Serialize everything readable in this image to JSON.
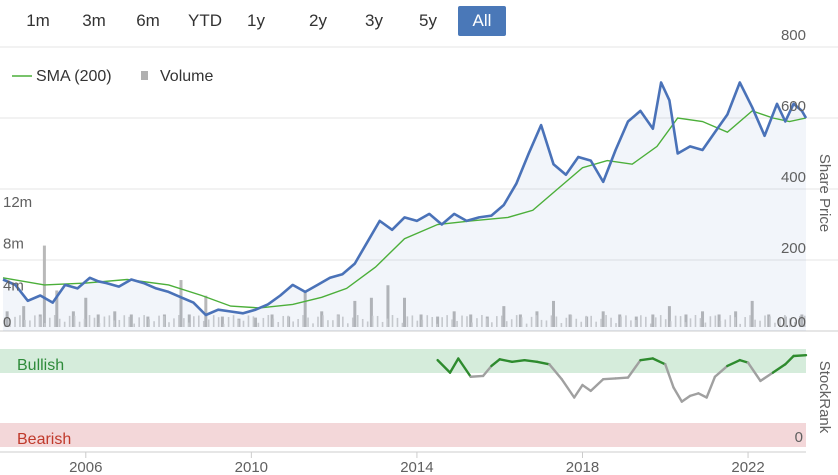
{
  "range_selector": {
    "buttons": [
      "1m",
      "3m",
      "6m",
      "YTD",
      "1y",
      "2y",
      "3y",
      "5y",
      "All"
    ],
    "active": "All"
  },
  "legend": {
    "sma_label": "SMA (200)",
    "volume_label": "Volume"
  },
  "colors": {
    "price": "#4a72b8",
    "sma": "#4caf3a",
    "volume": "#b9b9b9",
    "active_button": "#4a78b8",
    "bullish_band": "#d5ecdb",
    "bearish_band": "#f3d7d9",
    "bullish_text": "#2e8b3a",
    "bearish_text": "#c0392b",
    "stockrank_bull": "#2e8b2e",
    "stockrank_neutral": "#a0a0a0"
  },
  "chart_data": [
    {
      "type": "line",
      "title": "",
      "ylabel": "Share Price",
      "ylim": [
        0,
        800
      ],
      "y_ticks": [
        "800",
        "600",
        "400",
        "200",
        "0.00"
      ],
      "x_ticks": [
        "2006",
        "2010",
        "2014",
        "2018",
        "2022"
      ],
      "xlim": [
        2004.0,
        2023.4
      ],
      "series": [
        {
          "name": "Share Price",
          "x": [
            2004.0,
            2004.3,
            2004.6,
            2004.9,
            2005.2,
            2005.5,
            2005.8,
            2006.1,
            2006.3,
            2006.5,
            2006.8,
            2007.1,
            2007.4,
            2007.7,
            2008.0,
            2008.3,
            2008.6,
            2008.9,
            2009.2,
            2009.5,
            2009.8,
            2010.1,
            2010.4,
            2010.7,
            2011.0,
            2011.3,
            2011.6,
            2011.9,
            2012.2,
            2012.5,
            2012.8,
            2013.1,
            2013.4,
            2013.7,
            2014.0,
            2014.3,
            2014.6,
            2014.9,
            2015.2,
            2015.5,
            2015.8,
            2016.1,
            2016.4,
            2016.7,
            2017.0,
            2017.3,
            2017.6,
            2017.9,
            2018.2,
            2018.5,
            2018.8,
            2019.1,
            2019.4,
            2019.7,
            2019.9,
            2020.1,
            2020.3,
            2020.6,
            2020.9,
            2021.2,
            2021.5,
            2021.8,
            2022.1,
            2022.4,
            2022.7,
            2022.9,
            2023.1,
            2023.3,
            2023.4
          ],
          "values": [
            145,
            130,
            85,
            100,
            80,
            130,
            120,
            150,
            140,
            135,
            125,
            145,
            135,
            120,
            110,
            95,
            80,
            45,
            60,
            55,
            50,
            60,
            75,
            100,
            130,
            110,
            130,
            150,
            160,
            190,
            250,
            310,
            285,
            320,
            310,
            330,
            300,
            330,
            310,
            320,
            325,
            355,
            415,
            500,
            580,
            470,
            440,
            490,
            480,
            420,
            510,
            590,
            620,
            570,
            700,
            650,
            500,
            520,
            510,
            560,
            610,
            700,
            630,
            550,
            640,
            590,
            640,
            620,
            600
          ]
        },
        {
          "name": "SMA (200)",
          "x": [
            2004.0,
            2005.0,
            2006.0,
            2007.0,
            2008.0,
            2008.8,
            2009.5,
            2010.2,
            2011.0,
            2011.7,
            2012.3,
            2013.0,
            2013.7,
            2014.5,
            2015.3,
            2016.2,
            2016.8,
            2017.4,
            2018.0,
            2018.6,
            2019.2,
            2019.8,
            2020.3,
            2020.9,
            2021.5,
            2022.1,
            2022.6,
            2023.0,
            2023.4
          ],
          "values": [
            150,
            130,
            135,
            145,
            130,
            100,
            70,
            65,
            75,
            95,
            120,
            180,
            260,
            300,
            310,
            320,
            340,
            400,
            460,
            480,
            470,
            520,
            600,
            590,
            560,
            620,
            600,
            590,
            600
          ]
        }
      ]
    },
    {
      "type": "bar",
      "title": "",
      "ylabel": "",
      "ylim": [
        0,
        16000000
      ],
      "y_ticks": [
        "12m",
        "8m",
        "4m",
        "0"
      ],
      "series": [
        {
          "name": "Volume",
          "x": [
            2004.1,
            2004.5,
            2004.9,
            2005.0,
            2005.3,
            2005.7,
            2006.0,
            2006.3,
            2006.7,
            2007.1,
            2007.5,
            2007.9,
            2008.3,
            2008.5,
            2008.9,
            2009.3,
            2009.7,
            2010.1,
            2010.5,
            2010.9,
            2011.3,
            2011.7,
            2012.1,
            2012.5,
            2012.9,
            2013.3,
            2013.7,
            2014.1,
            2014.5,
            2014.9,
            2015.3,
            2015.7,
            2016.1,
            2016.5,
            2016.9,
            2017.3,
            2017.7,
            2018.1,
            2018.5,
            2018.9,
            2019.3,
            2019.7,
            2020.1,
            2020.5,
            2020.9,
            2021.3,
            2021.7,
            2022.1,
            2022.5,
            2022.9,
            2023.3
          ],
          "values": [
            1500000,
            2000000,
            1200000,
            7800000,
            3500000,
            1500000,
            2800000,
            1200000,
            1500000,
            1200000,
            1000000,
            1200000,
            4500000,
            1200000,
            3000000,
            1000000,
            800000,
            900000,
            1200000,
            1000000,
            3500000,
            1500000,
            1200000,
            2500000,
            2800000,
            4000000,
            2800000,
            1200000,
            1000000,
            1500000,
            1200000,
            1000000,
            2000000,
            1200000,
            1500000,
            2500000,
            1200000,
            1000000,
            1500000,
            1200000,
            1000000,
            1200000,
            2000000,
            1200000,
            1500000,
            1200000,
            1500000,
            2500000,
            1200000,
            1000000,
            1200000
          ]
        }
      ]
    },
    {
      "type": "line",
      "title": "",
      "ylabel": "StockRank",
      "ylim": [
        0,
        100
      ],
      "y_ticks": [
        "0"
      ],
      "band_labels": {
        "top": "Bullish",
        "bottom": "Bearish"
      },
      "series": [
        {
          "name": "StockRank",
          "x": [
            2014.5,
            2014.8,
            2015.0,
            2015.3,
            2015.6,
            2015.8,
            2016.0,
            2016.3,
            2016.6,
            2016.9,
            2017.2,
            2017.5,
            2017.8,
            2018.0,
            2018.2,
            2018.5,
            2018.8,
            2019.1,
            2019.4,
            2019.7,
            2020.0,
            2020.2,
            2020.4,
            2020.6,
            2020.8,
            2021.0,
            2021.2,
            2021.5,
            2021.8,
            2022.0,
            2022.3,
            2022.6,
            2022.9,
            2023.1,
            2023.4
          ],
          "values": [
            95,
            80,
            97,
            75,
            76,
            88,
            96,
            93,
            95,
            93,
            90,
            72,
            50,
            65,
            58,
            72,
            73,
            74,
            95,
            97,
            90,
            62,
            45,
            52,
            55,
            50,
            75,
            88,
            95,
            92,
            70,
            80,
            90,
            100,
            101
          ]
        }
      ]
    }
  ]
}
